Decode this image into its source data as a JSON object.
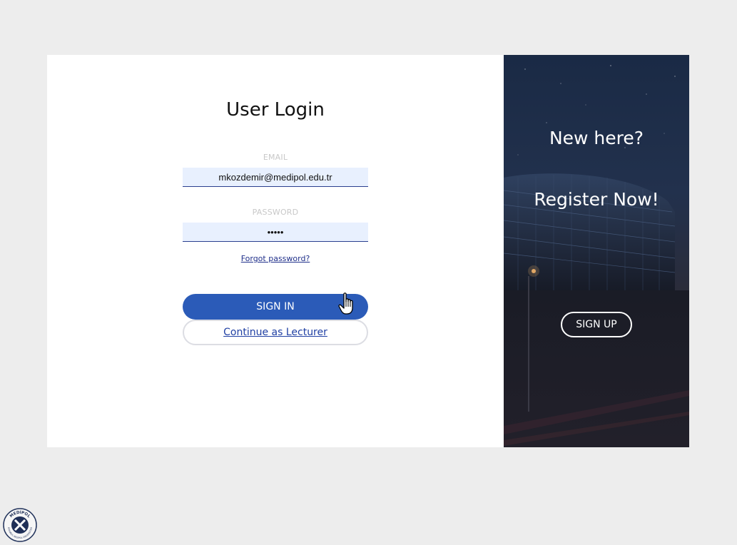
{
  "login": {
    "title": "User Login",
    "email_label": "EMAIL",
    "email_value": "mkozdemir@medipol.edu.tr",
    "password_label": "PASSWORD",
    "password_value": "•••••",
    "forgot_link": "Forgot password?",
    "signin_button": "SIGN IN",
    "lecturer_button": "Continue as Lecturer"
  },
  "register": {
    "heading_line1": "New here?",
    "heading_line2": "Register Now!",
    "signup_button": "SIGN UP"
  },
  "branding": {
    "logo_text": "MEDİPOL",
    "logo_subtext": "İSTANBUL MEDİPOL ÜNİVERSİTESİ"
  },
  "colors": {
    "accent": "#2b5bb8",
    "page_background": "#ededed",
    "input_autofill": "#e8f0fe",
    "link": "#1f2f8a"
  },
  "icons": {
    "cursor": "pointer-hand-icon",
    "logo": "medipol-logo-icon"
  }
}
